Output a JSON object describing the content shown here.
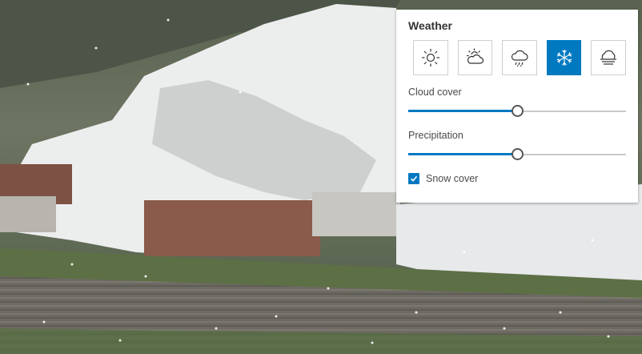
{
  "weather_panel": {
    "title": "Weather",
    "presets": [
      {
        "icon": "sunny-icon",
        "selected": false
      },
      {
        "icon": "cloudy-icon",
        "selected": false
      },
      {
        "icon": "rainy-icon",
        "selected": false
      },
      {
        "icon": "snowy-icon",
        "selected": true
      },
      {
        "icon": "foggy-icon",
        "selected": false
      }
    ],
    "cloud_cover": {
      "label": "Cloud cover",
      "value": 0.5
    },
    "precipitation": {
      "label": "Precipitation",
      "value": 0.5
    },
    "snow_cover": {
      "label": "Snow cover",
      "checked": true
    }
  },
  "colors": {
    "accent": "#0079c1"
  }
}
